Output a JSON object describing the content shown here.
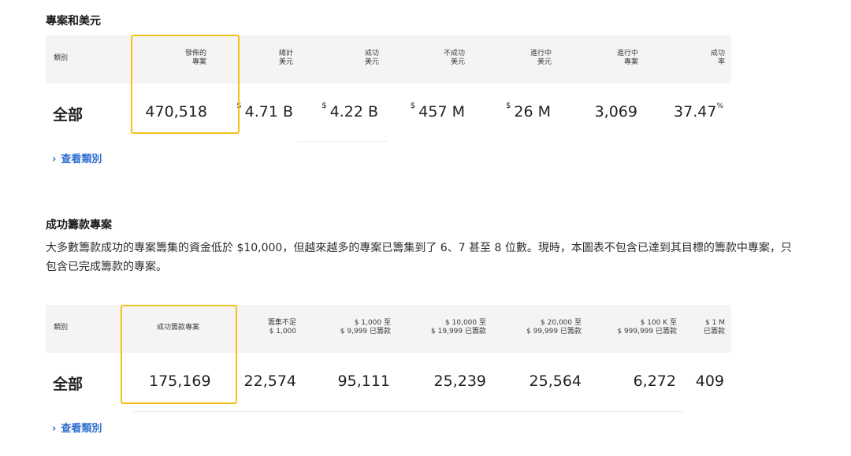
{
  "section1": {
    "title": "專案和美元",
    "headers": {
      "category": "類別",
      "launched": "發佈的\n專案",
      "total": "總計\n美元",
      "success": "成功\n美元",
      "fail": "不成功\n美元",
      "live": "進行中\n美元",
      "live_proj": "進行中\n專案",
      "rate": "成功\n率"
    },
    "row": {
      "label": "全部",
      "launched": "470,518",
      "total_cur": "$",
      "total": "4.71 B",
      "success_cur": "$",
      "success": "4.22 B",
      "fail_cur": "$",
      "fail": "457 M",
      "live_cur": "$",
      "live": "26 M",
      "live_proj": "3,069",
      "rate": "37.47",
      "rate_unit": "%"
    },
    "link": "查看類別"
  },
  "section2": {
    "title": "成功籌款專案",
    "description": "大多數籌款成功的專案籌集的資金低於 $10,000，但越來越多的專案已籌集到了 6、7 甚至 8 位數。現時，本圖表不包含已達到其目標的籌款中專案，只包含已完成籌款的專案。",
    "headers": {
      "category": "類別",
      "funded": "成功籌款專案",
      "under1k": "籌集不足\n$ 1,000",
      "r1k": "$ 1,000 至\n$ 9,999 已籌款",
      "r10k": "$ 10,000 至\n$ 19,999 已籌款",
      "r20k": "$ 20,000 至\n$ 99,999 已籌款",
      "r100k": "$ 100 K 至\n$ 999,999 已籌款",
      "r1m": "$ 1 M\n已籌款"
    },
    "row": {
      "label": "全部",
      "funded": "175,169",
      "under1k": "22,574",
      "r1k": "95,111",
      "r10k": "25,239",
      "r20k": "25,564",
      "r100k": "6,272",
      "r1m": "409"
    },
    "link": "查看類別"
  },
  "colors": {
    "highlight": "#f3c11d",
    "link": "#2f6fd0",
    "header_bg": "#f4f4f3"
  },
  "icons": {
    "link_chevron": "chevron-right-icon"
  }
}
